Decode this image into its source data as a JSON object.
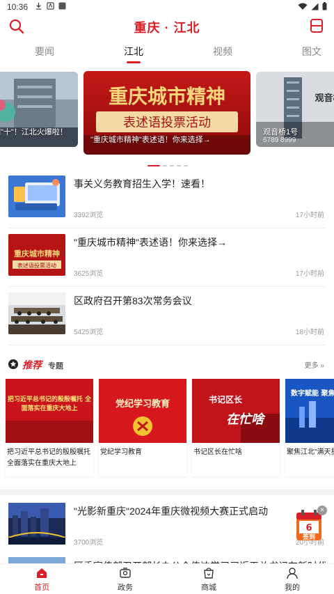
{
  "status_bar": {
    "time": "10:36"
  },
  "header": {
    "title": "重庆 · 江北",
    "accent_color": "#d9202a"
  },
  "tabs": [
    {
      "label": "要闻",
      "active": false
    },
    {
      "label": "江北",
      "active": true
    },
    {
      "label": "视频",
      "active": false
    },
    {
      "label": "图文",
      "active": false
    }
  ],
  "carousel": {
    "slides": [
      {
        "caption": "制\"十\"！江北火爆啦！",
        "caption_sub": ""
      },
      {
        "image_text_line1": "重庆城市精神",
        "image_text_line2": "表述语投票活动",
        "caption": "\"重庆城市精神\"表述语！你来选择→"
      },
      {
        "image_text": "观音桥",
        "caption": "观音桥1号",
        "caption_sub": "6789 8999"
      }
    ],
    "active_index": 0,
    "count": 5
  },
  "news": [
    {
      "headline": "事关义务教育招生入学！速看！",
      "views": "3392浏览",
      "time": "17小时前",
      "thumb": "education-illustration"
    },
    {
      "headline": "\"重庆城市精神\"表述语！你来选择→",
      "views": "3625浏览",
      "time": "17小时前",
      "thumb": "city-spirit-poster",
      "thumb_text1": "重庆城市精神",
      "thumb_text2": "表述语投票活动"
    },
    {
      "headline": "区政府召开第83次常务会议",
      "views": "5425浏览",
      "time": "18小时前",
      "thumb": "meeting-photo"
    }
  ],
  "recommend": {
    "title": "推荐",
    "subtitle": "专题",
    "more": "更多 »",
    "cards": [
      {
        "label": "把习近平总书记的殷殷嘱托全面落实在重庆大地上",
        "image_text": "把习近平总书记的殷殷嘱托 全面落实在重庆大地上"
      },
      {
        "label": "党纪学习教育",
        "image_text": "党纪学习教育"
      },
      {
        "label": "书记区长在忙啥",
        "image_text1": "书记区长",
        "image_text2": "在忙啥"
      },
      {
        "label": "聚焦江北\"满天星",
        "image_text": "数字赋能 聚焦江北"
      }
    ]
  },
  "bottom_news": {
    "headline": "\"光影新重庆\"2024年重庆微视频大赛正式启动",
    "views": "3700浏览",
    "time": "20小时前",
    "partial_headline": "区委宣传部召开部长办公会传达学习习近平总书记在新时代"
  },
  "signin_badge": {
    "day": "6",
    "label": "签到"
  },
  "bottom_nav": [
    {
      "label": "首页",
      "icon": "home-icon",
      "active": true
    },
    {
      "label": "政务",
      "icon": "government-icon",
      "active": false
    },
    {
      "label": "商城",
      "icon": "shop-icon",
      "active": false
    },
    {
      "label": "我的",
      "icon": "profile-icon",
      "active": false
    }
  ]
}
